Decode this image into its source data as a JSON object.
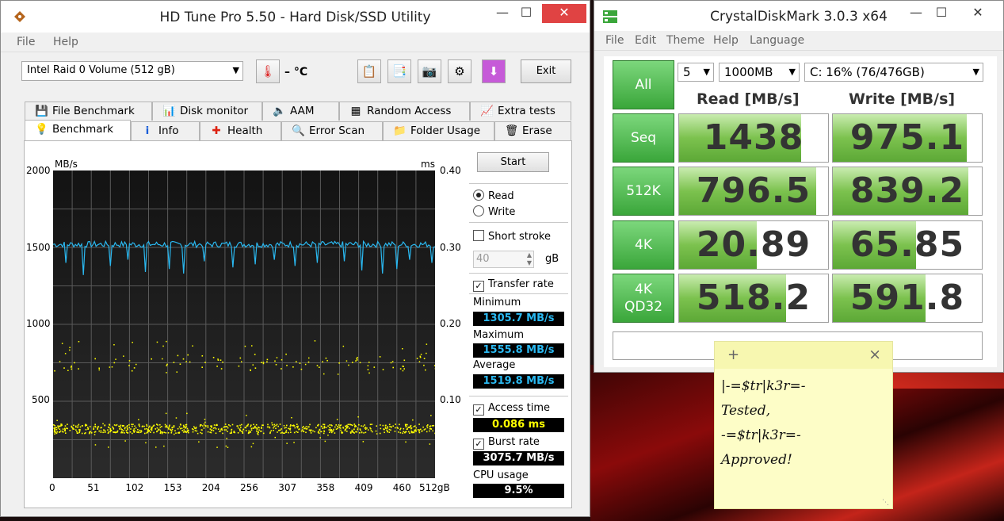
{
  "hdtune": {
    "title": "HD Tune Pro 5.50 - Hard Disk/SSD Utility",
    "menu": [
      "File",
      "Help"
    ],
    "drive": "Intel   Raid 0 Volume (512 gB)",
    "temperature": "– °C",
    "exit": "Exit",
    "tabs_top": [
      "File Benchmark",
      "Disk monitor",
      "AAM",
      "Random Access",
      "Extra tests"
    ],
    "tabs_bottom": [
      "Benchmark",
      "Info",
      "Health",
      "Error Scan",
      "Folder Usage",
      "Erase"
    ],
    "start": "Start",
    "read": "Read",
    "write": "Write",
    "short_stroke": "Short stroke",
    "stroke_value": "40",
    "stroke_unit": "gB",
    "transfer_rate": "Transfer rate",
    "minimum_label": "Minimum",
    "minimum": "1305.7 MB/s",
    "maximum_label": "Maximum",
    "maximum": "1555.8 MB/s",
    "average_label": "Average",
    "average": "1519.8 MB/s",
    "access_time_label": "Access time",
    "access_time": "0.086 ms",
    "burst_rate_label": "Burst rate",
    "burst_rate": "3075.7 MB/s",
    "cpu_label": "CPU usage",
    "cpu": "9.5%"
  },
  "chart_data": {
    "type": "line",
    "ylabel_left": "MB/s",
    "ylabel_right": "ms",
    "xlabel": "gB",
    "ylim": [
      0,
      2000
    ],
    "y2lim": [
      0,
      0.4
    ],
    "x_ticks": [
      "0",
      "51",
      "102",
      "153",
      "204",
      "256",
      "307",
      "358",
      "409",
      "460",
      "512gB"
    ],
    "y_ticks_left": [
      "2000",
      "1500",
      "1000",
      "500"
    ],
    "y_ticks_right": [
      "0.40",
      "0.30",
      "0.20",
      "0.10"
    ],
    "series": [
      {
        "name": "Transfer rate",
        "color": "#2ab8f0",
        "average": 1519.8,
        "min": 1305.7,
        "max": 1555.8
      },
      {
        "name": "Access time",
        "color": "#ffff00",
        "dense_band_ms": 0.065,
        "scatter_range_ms": [
          0.04,
          0.18
        ]
      }
    ],
    "grid": true
  },
  "cdm": {
    "title": "CrystalDiskMark 3.0.3 x64",
    "menu": [
      "File",
      "Edit",
      "Theme",
      "Help",
      "Language"
    ],
    "all": "All",
    "runs": "5",
    "size": "1000MB",
    "drive": "C: 16% (76/476GB)",
    "read_header": "Read [MB/s]",
    "write_header": "Write [MB/s]",
    "rows": [
      {
        "label": "Seq",
        "read": "1438",
        "write": "975.1",
        "read_fill": 0.82,
        "write_fill": 0.9
      },
      {
        "label": "512K",
        "read": "796.5",
        "write": "839.2",
        "read_fill": 0.92,
        "write_fill": 0.91
      },
      {
        "label": "4K",
        "read": "20.89",
        "write": "65.85",
        "read_fill": 0.52,
        "write_fill": 0.56
      },
      {
        "label": "4K\nQD32",
        "read": "518.2",
        "write": "591.8",
        "read_fill": 0.72,
        "write_fill": 0.62
      }
    ],
    "accent": "#4fb84f"
  },
  "note": {
    "plus": "+",
    "close": "×",
    "lines": [
      "|-=$tr|k3r=-",
      "Tested,",
      "-=$tr|k3r=-",
      "Approved!"
    ]
  }
}
